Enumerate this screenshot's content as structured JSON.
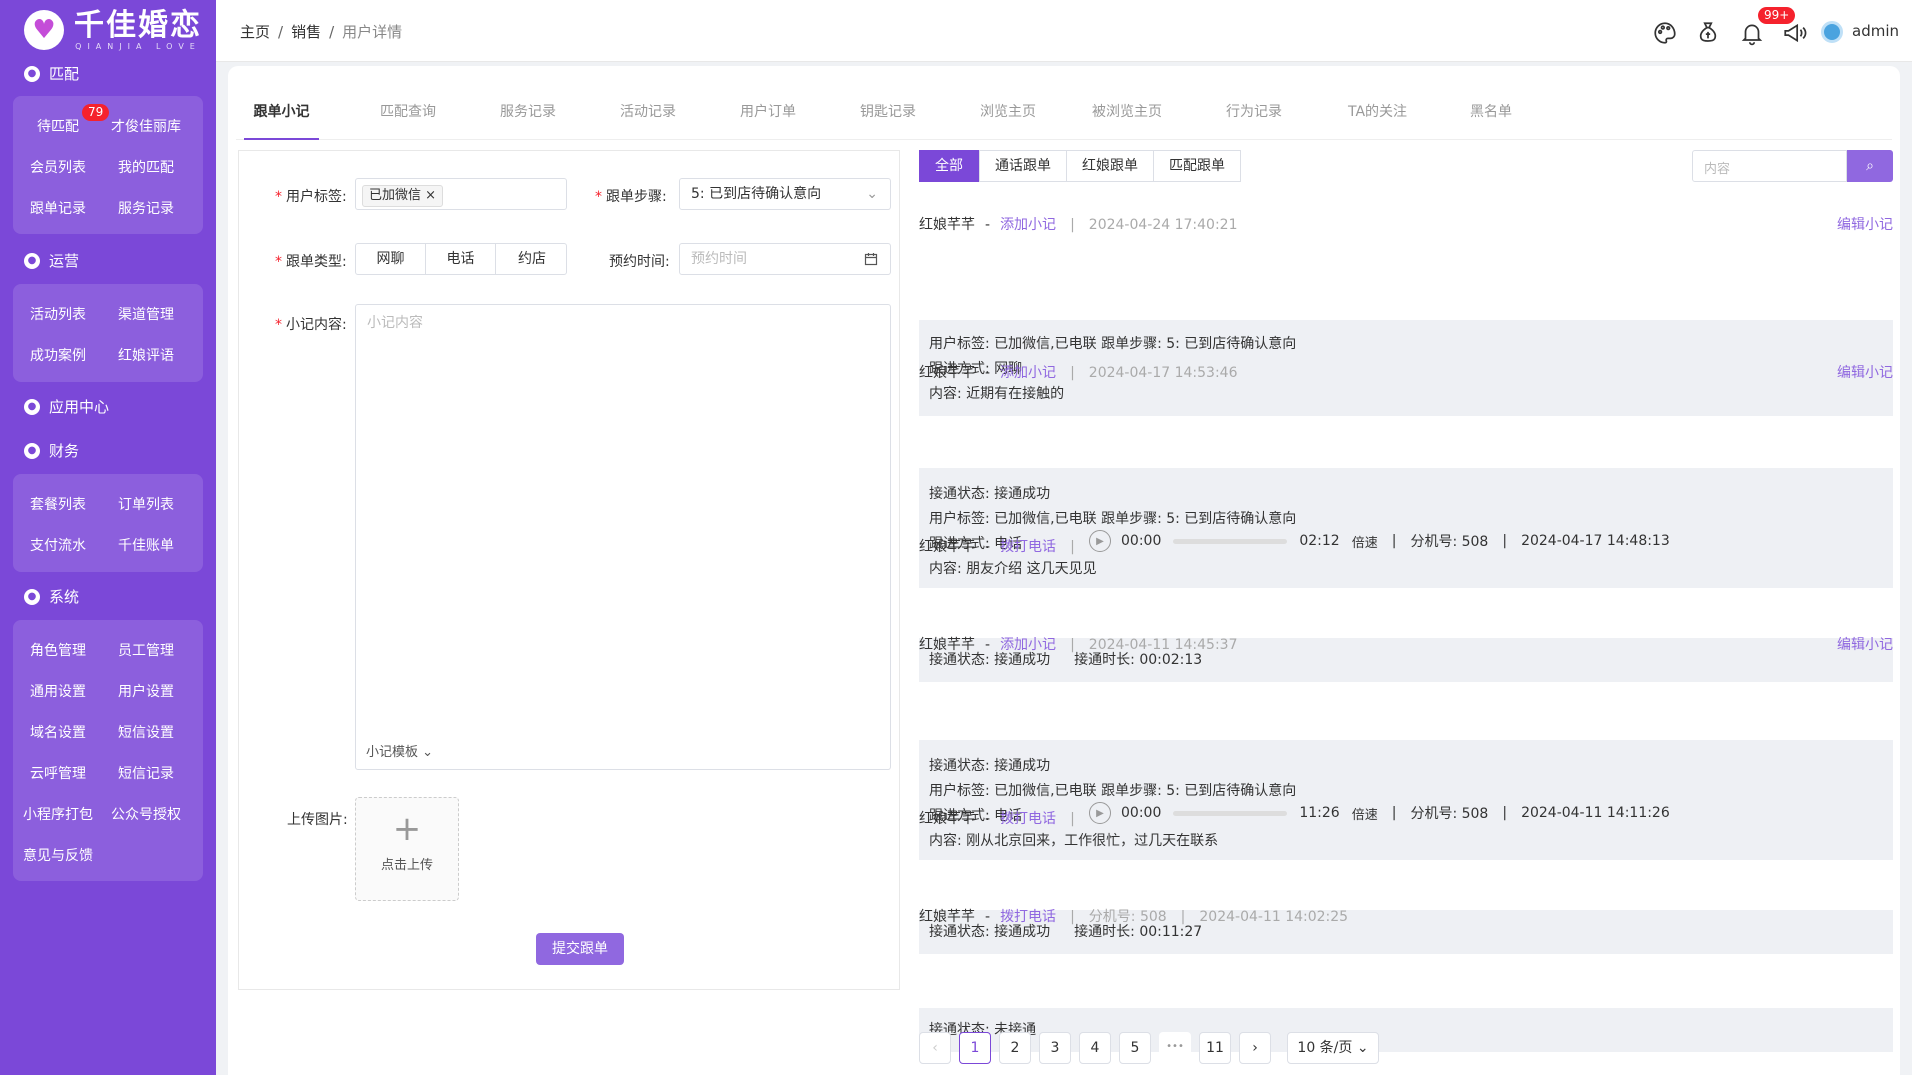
{
  "brand": {
    "name": "千佳婚恋",
    "sub": "QIANJIA LOVE"
  },
  "sidebar": {
    "sections": [
      {
        "label": "匹配",
        "items": [
          "待匹配",
          "才俊佳丽库",
          "会员列表",
          "我的匹配",
          "跟单记录",
          "服务记录"
        ],
        "badge": "79"
      },
      {
        "label": "运营",
        "items": [
          "活动列表",
          "渠道管理",
          "成功案例",
          "红娘评语"
        ]
      },
      {
        "label": "应用中心",
        "items": []
      },
      {
        "label": "财务",
        "items": [
          "套餐列表",
          "订单列表",
          "支付流水",
          "千佳账单"
        ]
      },
      {
        "label": "系统",
        "items": [
          "角色管理",
          "员工管理",
          "通用设置",
          "用户设置",
          "域名设置",
          "短信设置",
          "云呼管理",
          "短信记录",
          "小程序打包",
          "公众号授权",
          "意见与反馈"
        ]
      }
    ]
  },
  "topbar": {
    "breadcrumb": [
      "主页",
      "销售",
      "用户详情"
    ],
    "notif_badge": "99+",
    "user": "admin",
    "icons": [
      "palette-icon",
      "money-bag-icon",
      "bell-icon",
      "megaphone-icon"
    ]
  },
  "tabs": [
    "跟单小记",
    "匹配查询",
    "服务记录",
    "活动记录",
    "用户订单",
    "钥匙记录",
    "浏览主页",
    "被浏览主页",
    "行为记录",
    "TA的关注",
    "黑名单"
  ],
  "form": {
    "user_tag_label": "用户标签:",
    "user_tag_value": "已加微信",
    "step_label": "跟单步骤:",
    "step_value": "5: 已到店待确认意向",
    "type_label": "跟单类型:",
    "type_options": [
      "网聊",
      "电话",
      "约店"
    ],
    "appt_label": "预约时间:",
    "appt_placeholder": "预约时间",
    "note_label": "小记内容:",
    "note_placeholder": "小记内容",
    "template": "小记模板",
    "upload_label": "上传图片:",
    "upload_text": "点击上传",
    "submit": "提交跟单"
  },
  "filters": [
    "全部",
    "通话跟单",
    "红娘跟单",
    "匹配跟单"
  ],
  "search_placeholder": "内容",
  "records": [
    {
      "who": "红娘芊芊",
      "action": "添加小记",
      "time": "2024-04-24 17:40:21",
      "edit": "编辑小记",
      "lines": [
        "用户标签: 已加微信,已电联 跟单步骤: 5: 已到店待确认意向",
        "跟进方式: 网聊",
        "内容: 近期有在接触的"
      ]
    },
    {
      "who": "红娘芊芊",
      "action": "添加小记",
      "time": "2024-04-17 14:53:46",
      "edit": "编辑小记",
      "lines": [
        "接通状态: 接通成功",
        "用户标签: 已加微信,已电联 跟单步骤: 5: 已到店待确认意向",
        "跟进方式: 电话",
        "内容: 朋友介绍 这几天见见"
      ]
    },
    {
      "who": "红娘芊芊",
      "action": "拨打电话",
      "start": "00:00",
      "end": "02:12",
      "speed": "倍速",
      "ext": "分机号: 508",
      "time": "2024-04-17 14:48:13",
      "status": "接通状态:  接通成功",
      "duration": "接通时长:  00:02:13"
    },
    {
      "who": "红娘芊芊",
      "action": "添加小记",
      "time": "2024-04-11 14:45:37",
      "edit": "编辑小记",
      "lines": [
        "接通状态: 接通成功",
        "用户标签: 已加微信,已电联 跟单步骤: 5: 已到店待确认意向",
        "跟进方式: 电话",
        "内容: 刚从北京回来，工作很忙，过几天在联系"
      ]
    },
    {
      "who": "红娘芊芊",
      "action": "拨打电话",
      "start": "00:00",
      "end": "11:26",
      "speed": "倍速",
      "ext": "分机号: 508",
      "time": "2024-04-11 14:11:26",
      "status": "接通状态:  接通成功",
      "duration": "接通时长:  00:11:27"
    },
    {
      "who": "红娘芊芊",
      "action": "拨打电话",
      "ext": "分机号: 508",
      "time": "2024-04-11 14:02:25",
      "status": "接通状态:  未接通"
    }
  ],
  "pagination": {
    "pages": [
      "1",
      "2",
      "3",
      "4",
      "5"
    ],
    "ellipsis": "•••",
    "last": "11",
    "current": "1",
    "page_size": "10 条/页"
  },
  "colors": {
    "primary": "#7b48d8",
    "accent": "#9068e0",
    "badge": "#f5222d"
  }
}
